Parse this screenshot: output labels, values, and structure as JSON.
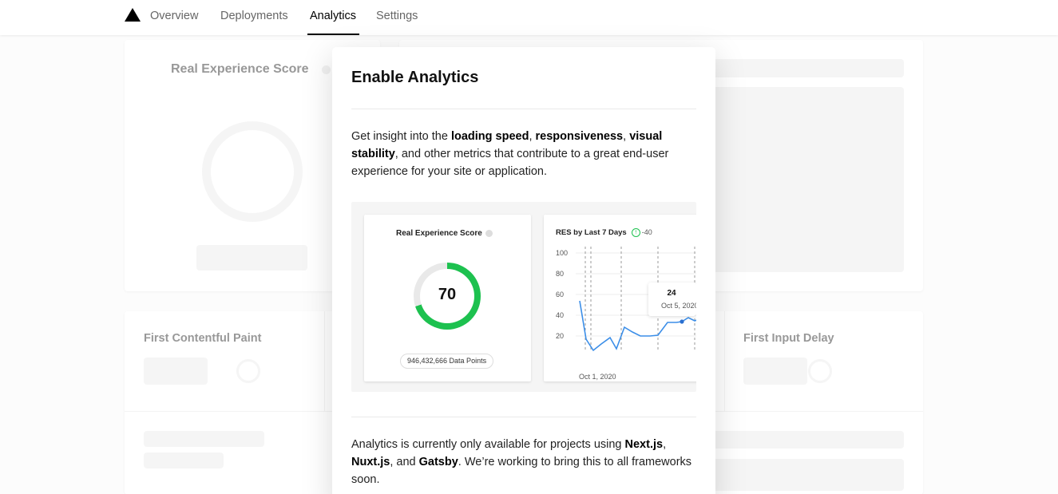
{
  "nav": {
    "tabs": [
      {
        "label": "Overview"
      },
      {
        "label": "Deployments"
      },
      {
        "label": "Analytics"
      },
      {
        "label": "Settings"
      }
    ],
    "active_tab": "Analytics"
  },
  "background": {
    "res_title": "Real Experience Score",
    "fcp_title": "First Contentful Paint",
    "fid_title": "First Input Delay"
  },
  "modal": {
    "title": "Enable Analytics",
    "intro": {
      "t1": "Get insight into the ",
      "b1": "loading speed",
      "t2": ", ",
      "b2": "responsiveness",
      "t3": ", ",
      "b3": "visual stability",
      "t4": ", and other metrics that contribute to a great end-user experience for your site or application."
    },
    "preview": {
      "score_card_title": "Real Experience Score",
      "score": "70",
      "data_points": "946,432,666 Data Points",
      "chart_title": "RES by Last 7 Days",
      "chart_delta": "-40",
      "y_ticks": [
        "100",
        "80",
        "60",
        "40",
        "20"
      ],
      "x_label": "Oct 1, 2020",
      "tooltip_value": "24",
      "tooltip_date": "Oct 5, 2020"
    },
    "note": {
      "t1": "Analytics is currently only available for projects using ",
      "b1": "Next.js",
      "t2": ", ",
      "b2": "Nuxt.js",
      "t3": ", and ",
      "b3": "Gatsby",
      "t4": ". We’re working to bring this to all frameworks soon."
    }
  },
  "colors": {
    "accent_green": "#1dc14f",
    "chart_line": "#3b8ee8"
  }
}
